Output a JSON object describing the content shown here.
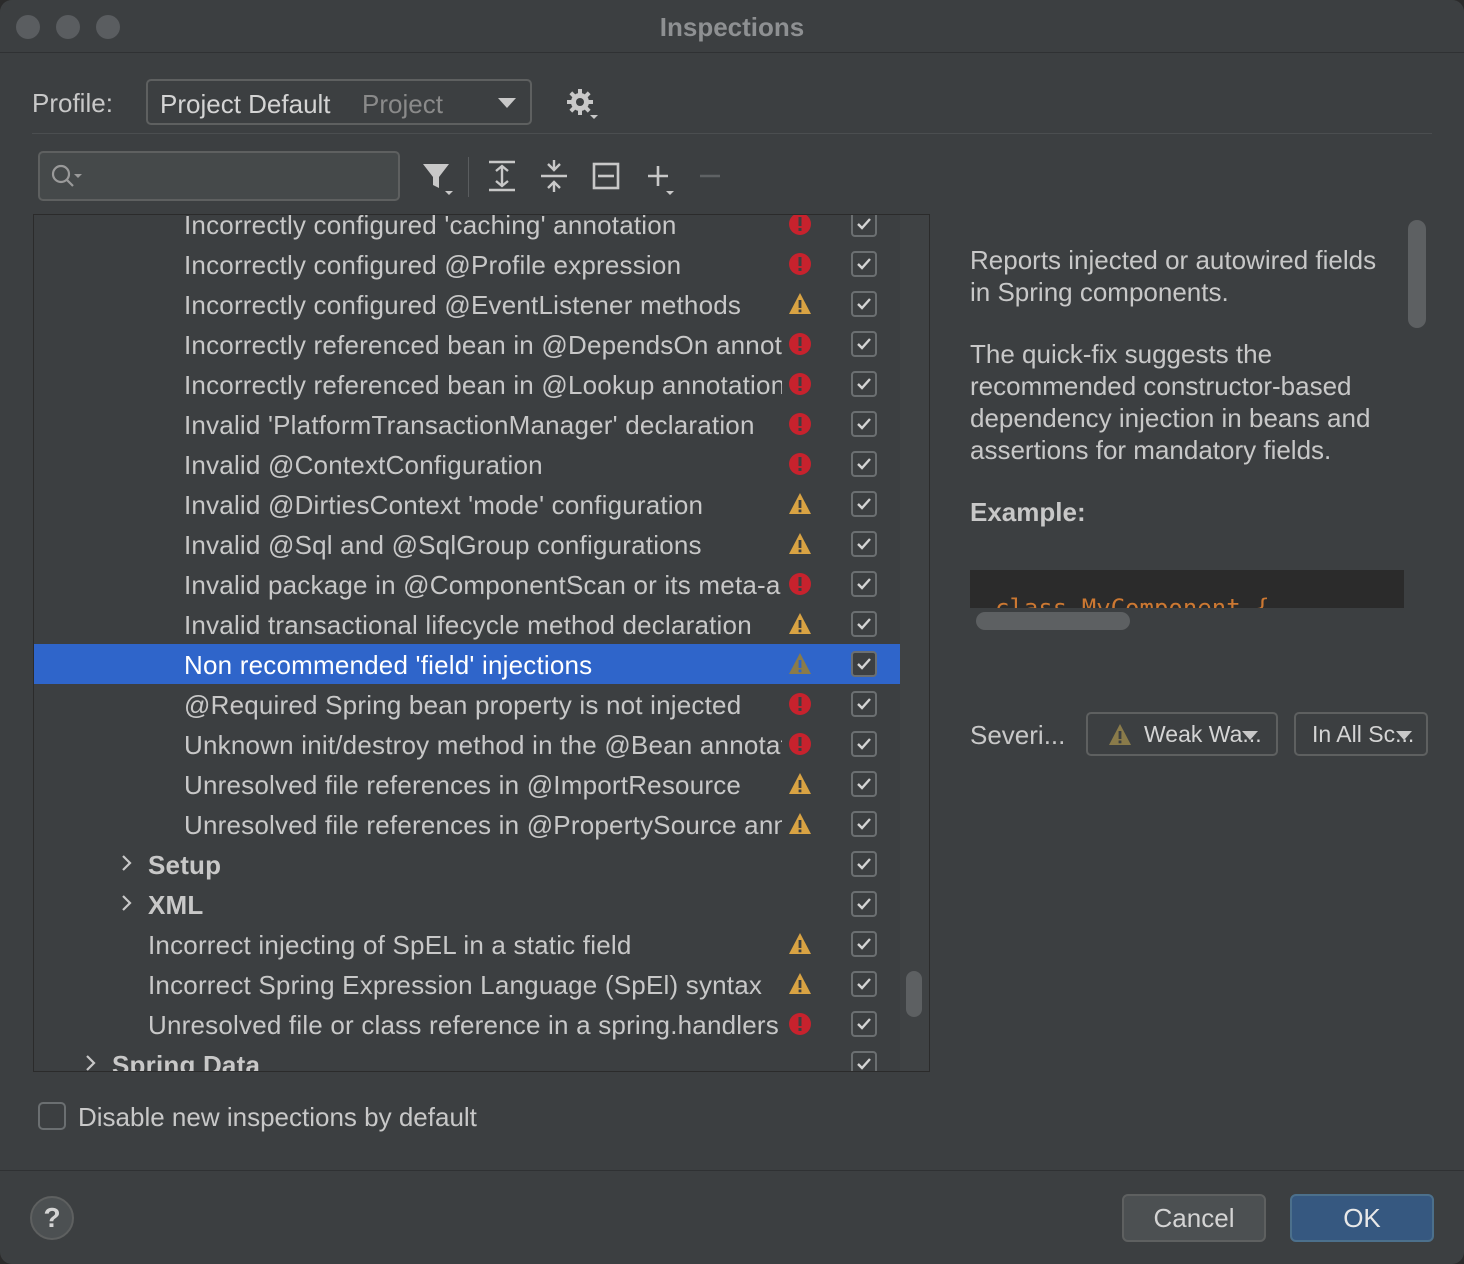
{
  "window": {
    "title": "Inspections"
  },
  "profile": {
    "label": "Profile:",
    "value": "Project Default",
    "scope": "Project"
  },
  "search": {
    "placeholder": ""
  },
  "toolbar": [
    "filter-icon",
    "expand-all-icon",
    "collapse-all-icon",
    "reset-icon",
    "add-icon",
    "remove-icon"
  ],
  "tree": {
    "rows": [
      {
        "label": "Incorrectly configured 'caching' annotation",
        "severity": "error",
        "checked": true,
        "indent": 2
      },
      {
        "label": "Incorrectly configured @Profile expression",
        "severity": "error",
        "checked": true,
        "indent": 2
      },
      {
        "label": "Incorrectly configured  @EventListener methods",
        "severity": "warning",
        "checked": true,
        "indent": 2
      },
      {
        "label": "Incorrectly referenced bean in @DependsOn annotation",
        "severity": "error",
        "checked": true,
        "indent": 2
      },
      {
        "label": "Incorrectly referenced bean in @Lookup annotation",
        "severity": "error",
        "checked": true,
        "indent": 2
      },
      {
        "label": "Invalid 'PlatformTransactionManager' declaration",
        "severity": "error",
        "checked": true,
        "indent": 2
      },
      {
        "label": "Invalid @ContextConfiguration",
        "severity": "error",
        "checked": true,
        "indent": 2
      },
      {
        "label": "Invalid @DirtiesContext 'mode' configuration",
        "severity": "warning",
        "checked": true,
        "indent": 2
      },
      {
        "label": "Invalid @Sql and @SqlGroup configurations",
        "severity": "warning",
        "checked": true,
        "indent": 2
      },
      {
        "label": "Invalid package in @ComponentScan or its meta-annotation",
        "severity": "error",
        "checked": true,
        "indent": 2
      },
      {
        "label": "Invalid transactional lifecycle method declaration",
        "severity": "warning",
        "checked": true,
        "indent": 2
      },
      {
        "label": "Non recommended 'field' injections",
        "severity": "weak",
        "checked": true,
        "indent": 2,
        "selected": true
      },
      {
        "label": "@Required Spring bean property is not injected",
        "severity": "error",
        "checked": true,
        "indent": 2
      },
      {
        "label": "Unknown init/destroy method in the @Bean annotation",
        "severity": "error",
        "checked": true,
        "indent": 2
      },
      {
        "label": "Unresolved file references in @ImportResource",
        "severity": "warning",
        "checked": true,
        "indent": 2
      },
      {
        "label": "Unresolved file references in @PropertySource annotation",
        "severity": "warning",
        "checked": true,
        "indent": 2
      },
      {
        "label": "Setup",
        "severity": "",
        "checked": true,
        "indent": 1,
        "group": true
      },
      {
        "label": "XML",
        "severity": "",
        "checked": true,
        "indent": 1,
        "group": true
      },
      {
        "label": "Incorrect injecting of SpEL in a static field",
        "severity": "warning",
        "checked": true,
        "indent": 1
      },
      {
        "label": "Incorrect Spring Expression Language (SpEl) syntax",
        "severity": "warning",
        "checked": true,
        "indent": 1
      },
      {
        "label": "Unresolved file or class reference in a spring.handlers file",
        "severity": "error",
        "checked": true,
        "indent": 1
      },
      {
        "label": "Spring Data",
        "severity": "",
        "checked": true,
        "indent": 0,
        "group": true
      }
    ]
  },
  "description": {
    "p1": "Reports injected or autowired fields in Spring components.",
    "p2": "The quick-fix suggests the recommended constructor-based dependency injection in beans and assertions for mandatory fields.",
    "example_label": "Example:",
    "code": "class MyComponent {"
  },
  "severity": {
    "label": "Severi...",
    "value": "Weak Wa...",
    "scope": "In All Sc..."
  },
  "options": {
    "disable_new_label": "Disable new inspections by default",
    "disable_new_checked": false
  },
  "footer": {
    "help": "?",
    "cancel": "Cancel",
    "ok": "OK"
  },
  "colors": {
    "selection": "#2f65ca",
    "error": "#c7222d",
    "warning": "#d9a343",
    "weak": "#8a7b4a",
    "ok_button": "#365880"
  }
}
